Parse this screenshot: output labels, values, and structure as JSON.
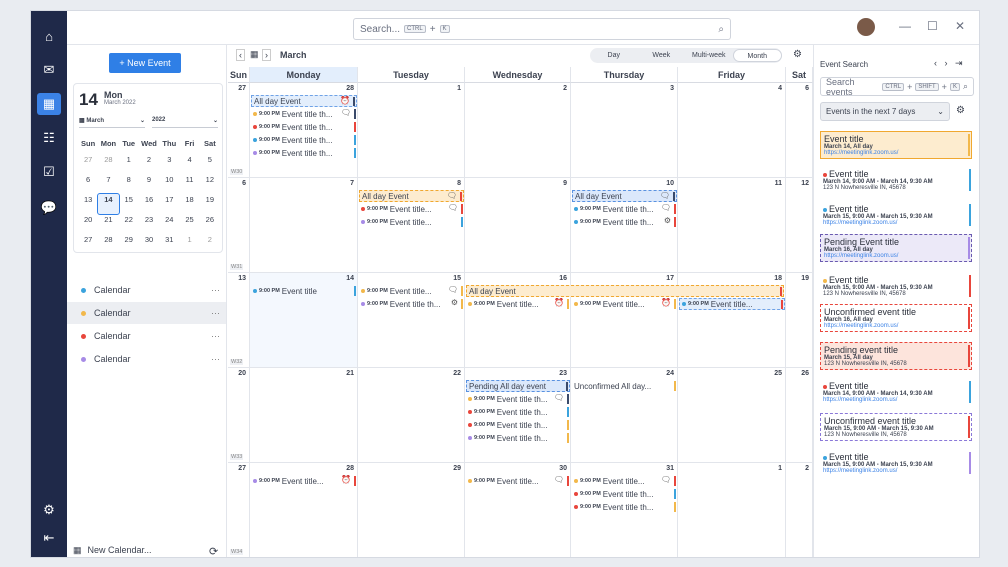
{
  "search": {
    "placeholder": "Search...",
    "k1": "CTRL",
    "k2": "K"
  },
  "sidebar": {
    "new_event": "+ New Event",
    "new_calendar": "New Calendar...",
    "mini": {
      "day": "14",
      "dow": "Mon",
      "month_year": "March 2022",
      "month_sel": "March",
      "year_sel": "2022",
      "weekdays": [
        "Sun",
        "Mon",
        "Tue",
        "Wed",
        "Thu",
        "Fri",
        "Sat"
      ],
      "weeks": [
        [
          "27",
          "28",
          "1",
          "2",
          "3",
          "4",
          "5"
        ],
        [
          "6",
          "7",
          "8",
          "9",
          "10",
          "11",
          "12"
        ],
        [
          "13",
          "14",
          "15",
          "16",
          "17",
          "18",
          "19"
        ],
        [
          "20",
          "21",
          "22",
          "23",
          "24",
          "25",
          "26"
        ],
        [
          "27",
          "28",
          "29",
          "30",
          "31",
          "1",
          "2"
        ]
      ]
    },
    "calendars": [
      {
        "label": "Calendar",
        "color": "#3ba3dd"
      },
      {
        "label": "Calendar",
        "color": "#f2b84b"
      },
      {
        "label": "Calendar",
        "color": "#e8463c"
      },
      {
        "label": "Calendar",
        "color": "#a78be6"
      }
    ]
  },
  "toolbar": {
    "month": "March",
    "views": [
      "Day",
      "Week",
      "Multi-week",
      "Month"
    ]
  },
  "weekdays": [
    "Sun",
    "Monday",
    "Tuesday",
    "Wednesday",
    "Thursday",
    "Friday",
    "Sat"
  ],
  "weeks": [
    {
      "wk": "W30",
      "days": [
        "27",
        "28",
        "1",
        "2",
        "3",
        "4",
        "6"
      ]
    },
    {
      "wk": "W31",
      "days": [
        "6",
        "7",
        "8",
        "9",
        "10",
        "11",
        "12"
      ]
    },
    {
      "wk": "W32",
      "days": [
        "13",
        "14",
        "15",
        "16",
        "17",
        "18",
        "19"
      ]
    },
    {
      "wk": "W33",
      "days": [
        "20",
        "21",
        "22",
        "23",
        "24",
        "25",
        "26"
      ]
    },
    {
      "wk": "W34",
      "days": [
        "27",
        "28",
        "29",
        "30",
        "31",
        "1",
        "2"
      ]
    }
  ],
  "events": {
    "all_day": "All day Event",
    "time": "9:00 PM",
    "title_a": "Event title th...",
    "title_b": "Event title...",
    "title_c": "Event title",
    "pending": "Pending All day event",
    "unconfirmed": "Unconfirmed All day..."
  },
  "right": {
    "title": "Event Search",
    "search": "Search events",
    "k1": "CTRL",
    "k2": "SHIFT",
    "k3": "K",
    "filter": "Events in the next 7 days",
    "results": [
      {
        "t": "Event title",
        "d": "March 14, All day",
        "l": "https://meetinglink.zoom.us/"
      },
      {
        "t": "Event title",
        "d": "March 14, 9:00 AM - March 14, 9:30 AM",
        "a": "123 N Nowheresville IN, 45678"
      },
      {
        "t": "Event title",
        "d": "March 15, 9:00 AM - March 15, 9:30 AM",
        "l": "https://meetinglink.zoom.us/"
      },
      {
        "t": "Pending Event title",
        "d": "March 16, All day",
        "l": "https://meetinglink.zoom.us/"
      },
      {
        "t": "Event title",
        "d": "March 15, 9:00 AM - March 15, 9:30 AM",
        "a": "123 N Nowheresville IN, 45678"
      },
      {
        "t": "Unconfirmed event title",
        "d": "March 16, All day",
        "l": "https://meetinglink.zoom.us/"
      },
      {
        "t": "Pending event title",
        "d": "March 15, All day",
        "a": "123 N Nowheresville IN, 45678"
      },
      {
        "t": "Event title",
        "d": "March 14, 9:00 AM - March 14, 9:30 AM",
        "l": "https://meetinglink.zoom.us/"
      },
      {
        "t": "Unconfirmed event title",
        "d": "March 15, 9:00 AM - March 15, 9:30 AM",
        "a": "123 N Nowheresville IN, 45678"
      },
      {
        "t": "Event title",
        "d": "March 15, 9:00 AM - March 15, 9:30 AM",
        "l": "https://meetinglink.zoom.us/"
      }
    ]
  },
  "colors": {
    "blue": "#3ba3dd",
    "orange": "#f2b84b",
    "red": "#e8463c",
    "purple": "#a78be6",
    "accent": "#2f7fe6"
  }
}
